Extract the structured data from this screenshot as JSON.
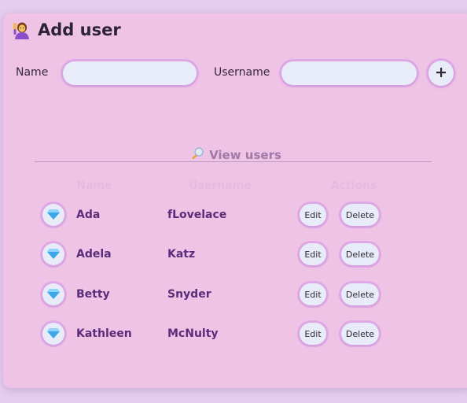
{
  "add_user": {
    "title": "Add user",
    "title_icon": "person-raising-hand-icon",
    "name_label": "Name",
    "name_value": "",
    "username_label": "Username",
    "username_value": "",
    "add_button_icon": "plus-icon"
  },
  "view_users": {
    "title": "View users",
    "title_icon": "magnifier-icon",
    "columns": [
      "Name",
      "Username",
      "Actions"
    ],
    "rows": [
      {
        "name": "Ada",
        "username": "fLovelace",
        "edit": "Edit",
        "delete": "Delete",
        "icon": "gem-icon"
      },
      {
        "name": "Adela",
        "username": "Katz",
        "edit": "Edit",
        "delete": "Delete",
        "icon": "gem-icon"
      },
      {
        "name": "Betty",
        "username": "Snyder",
        "edit": "Edit",
        "delete": "Delete",
        "icon": "gem-icon"
      },
      {
        "name": "Kathleen",
        "username": "McNulty",
        "edit": "Edit",
        "delete": "Delete",
        "icon": "gem-icon"
      }
    ]
  },
  "colors": {
    "page_background": "#e4cdee",
    "card_background": "#efc3e6",
    "accent_text": "#5a2d7a",
    "header_faded": "#e7b9df",
    "pill_fill": "#e8ecf8"
  }
}
